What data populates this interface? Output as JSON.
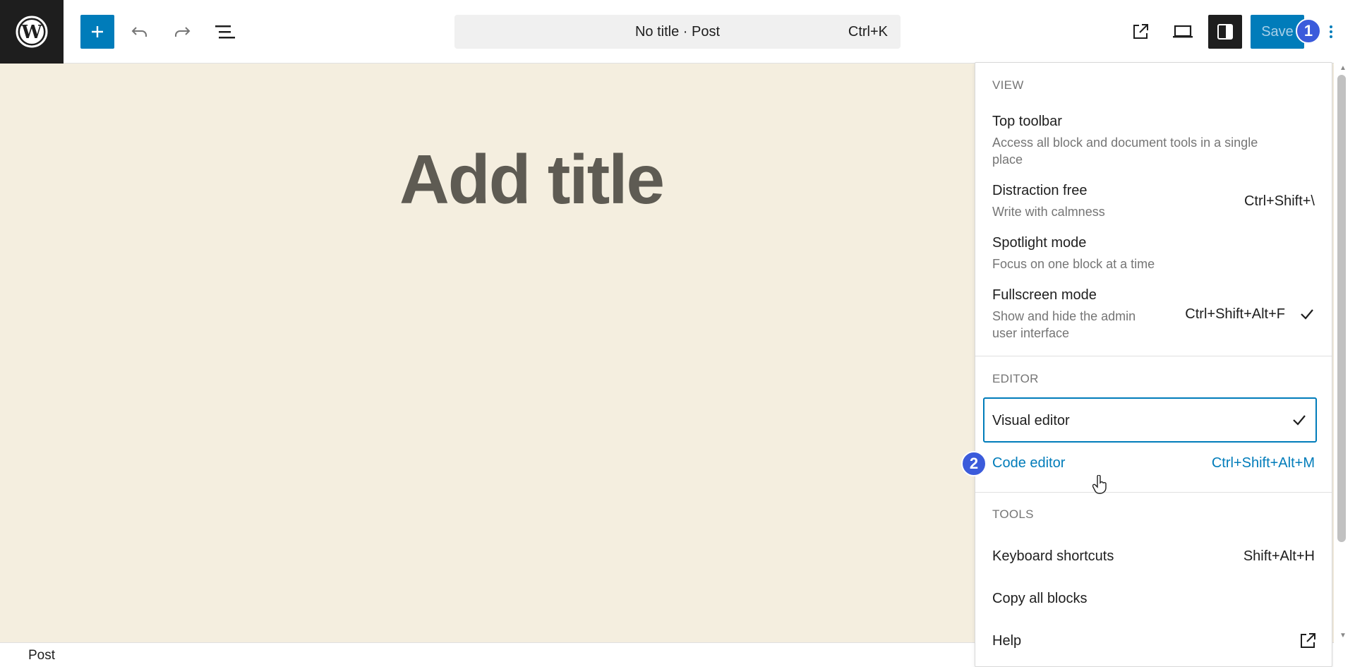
{
  "toolbar": {
    "document_title": "No title · Post",
    "command_shortcut": "Ctrl+K",
    "save_label": "Save"
  },
  "annotations": [
    "1",
    "2"
  ],
  "canvas": {
    "title_placeholder": "Add title"
  },
  "footer": {
    "breadcrumb": "Post"
  },
  "options_menu": {
    "view": {
      "label": "VIEW",
      "items": [
        {
          "title": "Top toolbar",
          "description": "Access all block and document tools in a single place",
          "desc_line1": "Access all block and document tools in a single",
          "desc_line2": "place"
        },
        {
          "title": "Distraction free",
          "description": "Write with calmness",
          "shortcut": "Ctrl+Shift+\\"
        },
        {
          "title": "Spotlight mode",
          "description": "Focus on one block at a time"
        },
        {
          "title": "Fullscreen mode",
          "description": "Show and hide the admin user interface",
          "desc_line1": "Show and hide the admin",
          "desc_line2": "user interface",
          "shortcut": "Ctrl+Shift+Alt+F",
          "checked": true
        }
      ]
    },
    "editor": {
      "label": "EDITOR",
      "items": [
        {
          "title": "Visual editor",
          "checked": true
        },
        {
          "title": "Code editor",
          "shortcut": "Ctrl+Shift+Alt+M"
        }
      ]
    },
    "tools": {
      "label": "TOOLS",
      "items": [
        {
          "title": "Keyboard shortcuts",
          "shortcut": "Shift+Alt+H"
        },
        {
          "title": "Copy all blocks"
        },
        {
          "title": "Help",
          "icon": "external-link-icon"
        }
      ]
    }
  },
  "colors": {
    "accent": "#007cba",
    "canvas_bg": "#f4eedf",
    "badge": "#3b5bdb"
  }
}
